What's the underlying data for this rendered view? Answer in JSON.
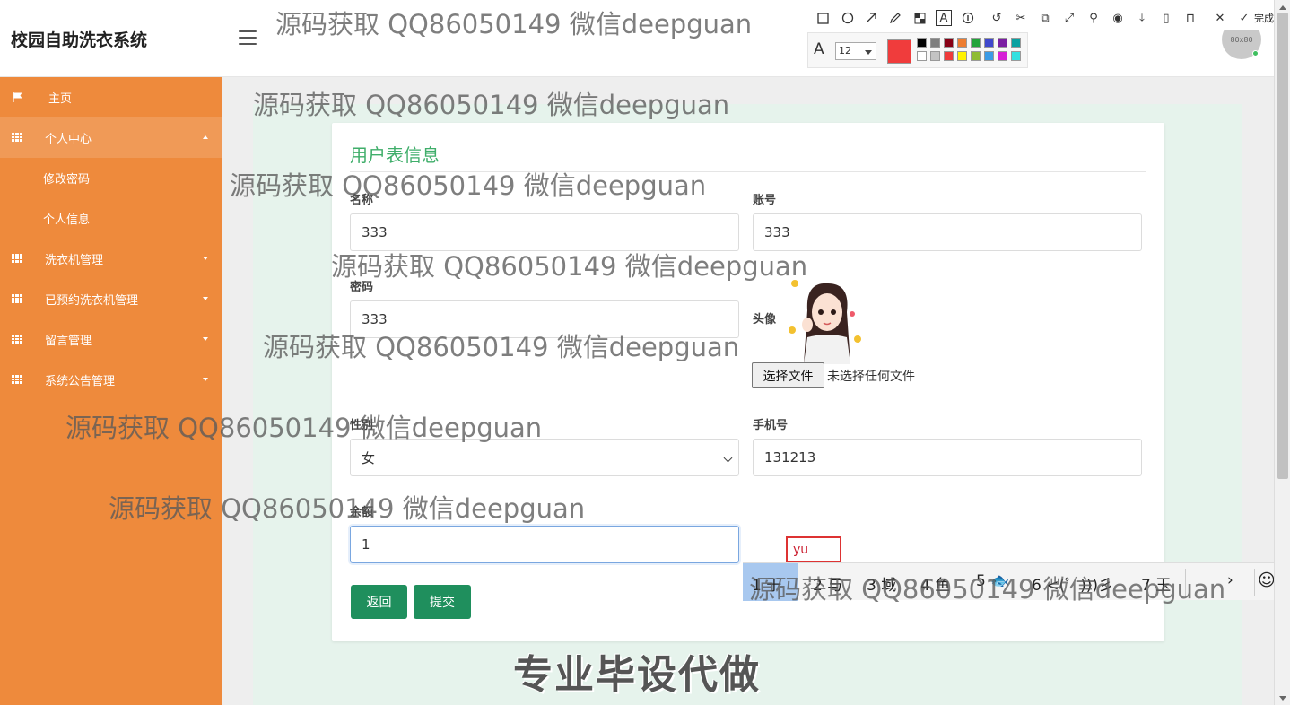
{
  "app": {
    "title": "校园自助洗衣系统",
    "avatar_text": "80x80"
  },
  "sidebar": {
    "items": [
      {
        "label": "主页",
        "icon": "flag-icon"
      },
      {
        "label": "个人中心",
        "icon": "grid-icon",
        "expanded": true,
        "children": [
          {
            "label": "修改密码"
          },
          {
            "label": "个人信息"
          }
        ]
      },
      {
        "label": "洗衣机管理",
        "icon": "grid-icon"
      },
      {
        "label": "已预约洗衣机管理",
        "icon": "grid-icon"
      },
      {
        "label": "留言管理",
        "icon": "grid-icon"
      },
      {
        "label": "系统公告管理",
        "icon": "grid-icon"
      }
    ]
  },
  "form": {
    "title": "用户表信息",
    "fields": {
      "name": {
        "label": "名称",
        "value": "333"
      },
      "account": {
        "label": "账号",
        "value": "333"
      },
      "password": {
        "label": "密码",
        "value": "333"
      },
      "avatar": {
        "label": "头像",
        "file_button": "选择文件",
        "file_status": "未选择任何文件"
      },
      "gender": {
        "label": "性别",
        "value": "女"
      },
      "phone": {
        "label": "手机号",
        "value": "131213"
      },
      "balance": {
        "label": "余额",
        "value": "1"
      }
    },
    "buttons": {
      "back": "返回",
      "submit": "提交"
    }
  },
  "ime": {
    "composition": "yu",
    "candidates": [
      "1 于",
      "2 与",
      "3 域",
      "4 鱼",
      "5 🐟",
      "6 <(゜)))彡",
      "7 玉"
    ]
  },
  "annotation_toolbar": {
    "done_label": "完成",
    "font_size": "12",
    "current_color": "#f03c3c",
    "palette": [
      "#000000",
      "#7f7f7f",
      "#880015",
      "#ed7d31",
      "#22a33a",
      "#3f48cc",
      "#7b1fa2",
      "#0aa1a1",
      "#ffffff",
      "#c3c3c3",
      "#ee3b3b",
      "#fff200",
      "#8fbc33",
      "#3b9be6",
      "#d61fd6",
      "#33e0e0"
    ]
  },
  "watermarks": {
    "text": "源码获取 QQ86050149 微信deepguan",
    "banner": "专业毕设代做"
  }
}
